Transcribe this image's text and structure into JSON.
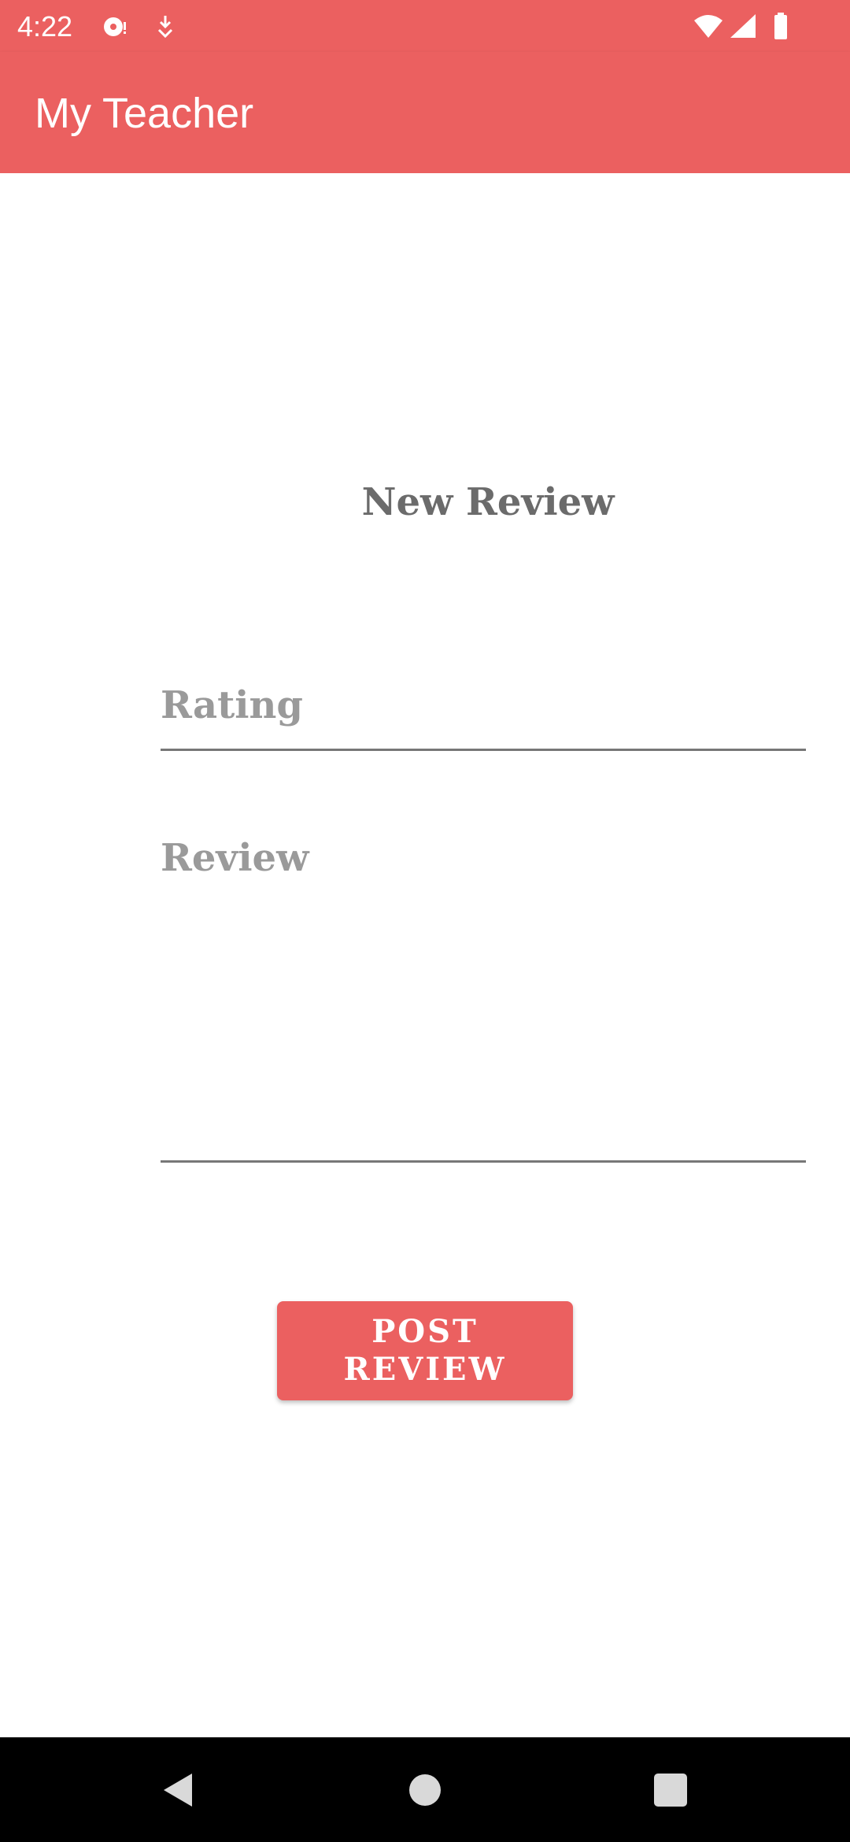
{
  "status_bar": {
    "time": "4:22",
    "left_icons": [
      "sync-icon",
      "download-icon"
    ],
    "right_icons": [
      "wifi-icon",
      "signal-icon",
      "battery-icon"
    ]
  },
  "app_bar": {
    "title": "My Teacher"
  },
  "form": {
    "heading": "New Review",
    "rating_placeholder": "Rating",
    "review_placeholder": "Review",
    "post_button_label": "POST REVIEW"
  },
  "nav_bar": {
    "buttons": [
      "back-icon",
      "home-icon",
      "recents-icon"
    ]
  },
  "colors": {
    "primary": "#EB6060",
    "heading_text": "#6b6b6b",
    "placeholder_text": "#9a9a9a",
    "nav_bar": "#000000"
  }
}
